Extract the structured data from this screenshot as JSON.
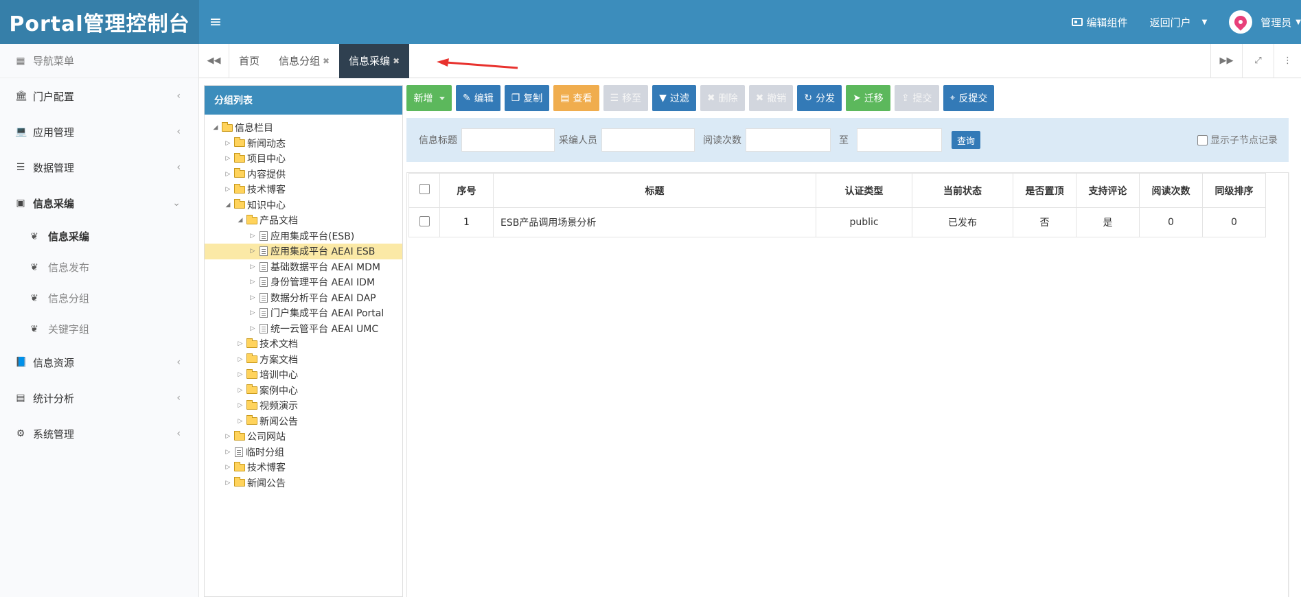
{
  "header": {
    "brand": "Portal管理控制台",
    "edit_component": "编辑组件",
    "back_portal": "返回门户",
    "user": "管理员"
  },
  "sidebar": {
    "nav_title": "导航菜单",
    "items": [
      {
        "label": "门户配置",
        "icon": "bank-icon"
      },
      {
        "label": "应用管理",
        "icon": "laptop-icon"
      },
      {
        "label": "数据管理",
        "icon": "list-icon"
      },
      {
        "label": "信息采编",
        "icon": "id-card-icon"
      }
    ],
    "subitems": [
      {
        "label": "信息采编",
        "active": true
      },
      {
        "label": "信息发布",
        "active": false
      },
      {
        "label": "信息分组",
        "active": false
      },
      {
        "label": "关键字组",
        "active": false
      }
    ],
    "items_after": [
      {
        "label": "信息资源",
        "icon": "book-icon"
      },
      {
        "label": "统计分析",
        "icon": "area-chart-icon"
      },
      {
        "label": "系统管理",
        "icon": "cogs-icon"
      }
    ]
  },
  "tabs": {
    "items": [
      {
        "label": "首页",
        "closable": false
      },
      {
        "label": "信息分组",
        "closable": true
      },
      {
        "label": "信息采编",
        "closable": true,
        "active": true
      }
    ]
  },
  "tree": {
    "title": "分组列表",
    "nodes": [
      {
        "label": "信息栏目",
        "depth": 0,
        "type": "folder",
        "expanded": true
      },
      {
        "label": "新闻动态",
        "depth": 1,
        "type": "folder"
      },
      {
        "label": "项目中心",
        "depth": 1,
        "type": "folder"
      },
      {
        "label": "内容提供",
        "depth": 1,
        "type": "folder"
      },
      {
        "label": "技术博客",
        "depth": 1,
        "type": "folder"
      },
      {
        "label": "知识中心",
        "depth": 1,
        "type": "folder",
        "expanded": true
      },
      {
        "label": "产品文档",
        "depth": 2,
        "type": "folder",
        "expanded": true
      },
      {
        "label": "应用集成平台(ESB)",
        "depth": 3,
        "type": "doc"
      },
      {
        "label": "应用集成平台 AEAI ESB",
        "depth": 3,
        "type": "doc",
        "selected": true
      },
      {
        "label": "基础数据平台 AEAI MDM",
        "depth": 3,
        "type": "doc"
      },
      {
        "label": "身份管理平台 AEAI IDM",
        "depth": 3,
        "type": "doc"
      },
      {
        "label": "数据分析平台 AEAI DAP",
        "depth": 3,
        "type": "doc"
      },
      {
        "label": "门户集成平台 AEAI Portal",
        "depth": 3,
        "type": "doc"
      },
      {
        "label": "统一云管平台 AEAI UMC",
        "depth": 3,
        "type": "doc"
      },
      {
        "label": "技术文档",
        "depth": 2,
        "type": "folder"
      },
      {
        "label": "方案文档",
        "depth": 2,
        "type": "folder"
      },
      {
        "label": "培训中心",
        "depth": 2,
        "type": "folder"
      },
      {
        "label": "案例中心",
        "depth": 2,
        "type": "folder"
      },
      {
        "label": "视频演示",
        "depth": 2,
        "type": "folder"
      },
      {
        "label": "新闻公告",
        "depth": 2,
        "type": "folder"
      },
      {
        "label": "公司网站",
        "depth": 1,
        "type": "folder"
      },
      {
        "label": "临时分组",
        "depth": 1,
        "type": "doc"
      },
      {
        "label": "技术博客",
        "depth": 1,
        "type": "folder"
      },
      {
        "label": "新闻公告",
        "depth": 1,
        "type": "folder"
      }
    ]
  },
  "toolbar": {
    "buttons": [
      {
        "label": "新增",
        "style": "green",
        "icon": "",
        "dropdown": true
      },
      {
        "label": "编辑",
        "style": "blue",
        "icon": "edit-icon"
      },
      {
        "label": "复制",
        "style": "blue",
        "icon": "copy-icon"
      },
      {
        "label": "查看",
        "style": "orange",
        "icon": "view-icon"
      },
      {
        "label": "移至",
        "style": "gray",
        "icon": "move-icon"
      },
      {
        "label": "过滤",
        "style": "blue",
        "icon": "filter-icon"
      },
      {
        "label": "删除",
        "style": "gray",
        "icon": "trash-icon"
      },
      {
        "label": "撤销",
        "style": "gray",
        "icon": "close-icon"
      },
      {
        "label": "分发",
        "style": "blue",
        "icon": "refresh-icon"
      },
      {
        "label": "迁移",
        "style": "green",
        "icon": "send-icon"
      },
      {
        "label": "提交",
        "style": "gray",
        "icon": "submit-icon"
      },
      {
        "label": "反提交",
        "style": "blue",
        "icon": "pin-icon"
      }
    ]
  },
  "search": {
    "title_label": "信息标题",
    "editor_label": "采编人员",
    "read_count_label": "阅读次数",
    "to_label": "至",
    "query_button": "查询",
    "show_child_label": "显示子节点记录"
  },
  "table": {
    "headers": [
      "序号",
      "标题",
      "认证类型",
      "当前状态",
      "是否置顶",
      "支持评论",
      "阅读次数",
      "同级排序"
    ],
    "rows": [
      [
        "1",
        "ESB产品调用场景分析",
        "public",
        "已发布",
        "否",
        "是",
        "0",
        "0"
      ]
    ]
  },
  "colors": {
    "header_bg": "#3c8dbc",
    "brand_bg": "#367fa9",
    "active_tab": "#2f4050",
    "annotation_arrow": "#e8322e"
  }
}
